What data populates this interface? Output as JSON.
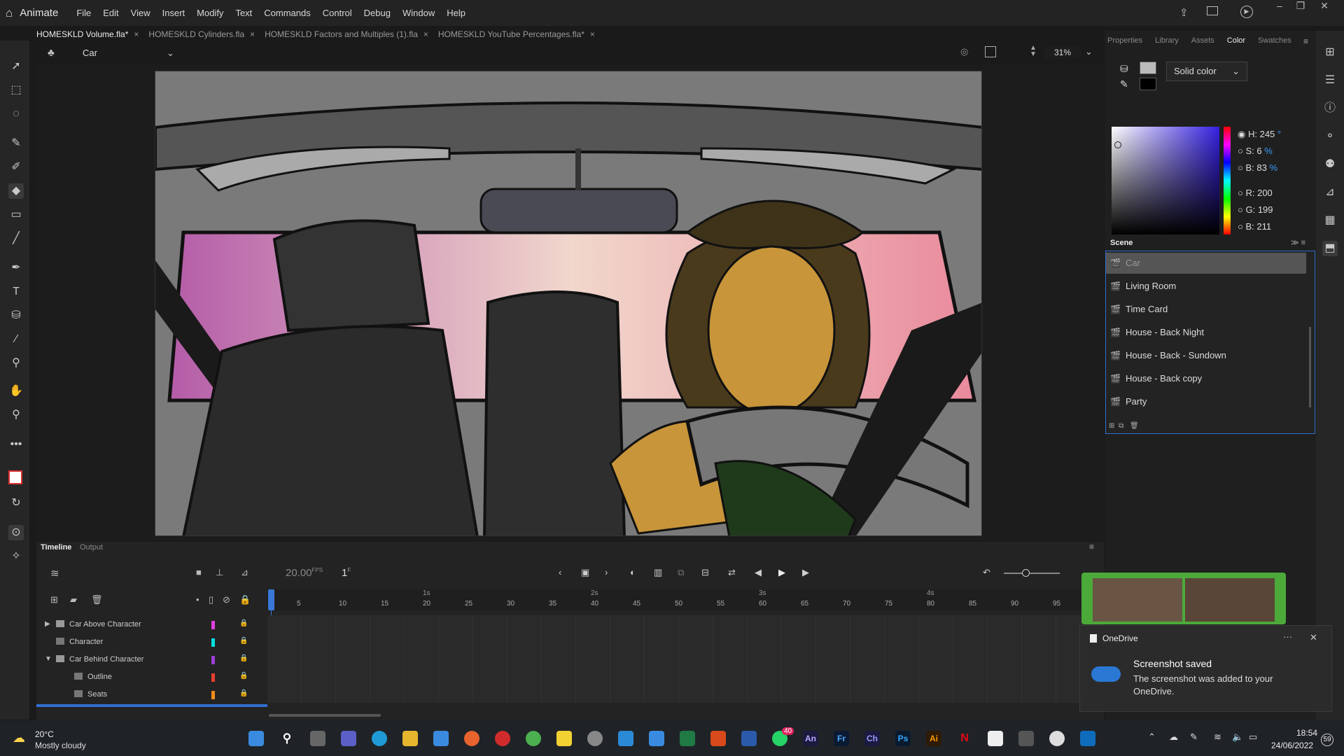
{
  "app": {
    "name": "Animate",
    "menu": [
      "File",
      "Edit",
      "View",
      "Insert",
      "Modify",
      "Text",
      "Commands",
      "Control",
      "Debug",
      "Window",
      "Help"
    ]
  },
  "doc_tabs": [
    {
      "label": "HOMESKLD Volume.fla*",
      "active": true
    },
    {
      "label": "HOMESKLD Cylinders.fla",
      "active": false
    },
    {
      "label": "HOMESKLD Factors and Multiples (1).fla",
      "active": false
    },
    {
      "label": "HOMESKLD YouTube Percentages.fla*",
      "active": false
    }
  ],
  "scene_selector": {
    "value": "Car"
  },
  "zoom": {
    "value": "31%"
  },
  "panel_tabs": [
    "Properties",
    "Library",
    "Assets",
    "Color",
    "Swatches"
  ],
  "color_panel": {
    "fill_type": "Solid color",
    "hsb": [
      {
        "label": "H:",
        "value": "245",
        "unit": "°"
      },
      {
        "label": "S:",
        "value": "6",
        "unit": "%"
      },
      {
        "label": "B:",
        "value": "83",
        "unit": "%"
      }
    ],
    "rgb": [
      {
        "label": "R:",
        "value": "200"
      },
      {
        "label": "G:",
        "value": "199"
      },
      {
        "label": "B:",
        "value": "211"
      }
    ]
  },
  "scene_panel": {
    "title": "Scene",
    "scenes": [
      "Car",
      "Living Room",
      "Time Card",
      "House - Back Night",
      "House - Back - Sundown",
      "House - Back copy",
      "Party"
    ]
  },
  "timeline": {
    "tabs": [
      "Timeline",
      "Output"
    ],
    "fps": "20.00",
    "fps_unit": "FPS",
    "frame": "1",
    "frame_unit": "F",
    "seconds": [
      "1s",
      "2s",
      "3s",
      "4s"
    ],
    "frames": [
      "5",
      "10",
      "15",
      "20",
      "25",
      "30",
      "35",
      "40",
      "45",
      "50",
      "55",
      "60",
      "65",
      "70",
      "75",
      "80",
      "85",
      "90",
      "95"
    ],
    "layers": [
      {
        "name": "Car Above Character",
        "color": "#e040e0",
        "type": "folder"
      },
      {
        "name": "Character",
        "color": "#00e0e0",
        "type": "layer"
      },
      {
        "name": "Car Behind Character",
        "color": "#9b3fd6",
        "type": "folder-open"
      },
      {
        "name": "Outline",
        "color": "#e84030",
        "type": "layer"
      },
      {
        "name": "Seats",
        "color": "#f08a1a",
        "type": "layer"
      }
    ]
  },
  "toast": {
    "app": "OneDrive",
    "title": "Screenshot saved",
    "body": "The screenshot was added to your OneDrive."
  },
  "taskbar": {
    "weather_temp": "20°C",
    "weather_desc": "Mostly cloudy",
    "time": "18:54",
    "date": "24/06/2022",
    "notif_count": "59",
    "whatsapp_badge": "40",
    "icons": [
      "An",
      "Fr",
      "Ch",
      "Ps",
      "Ai"
    ]
  }
}
